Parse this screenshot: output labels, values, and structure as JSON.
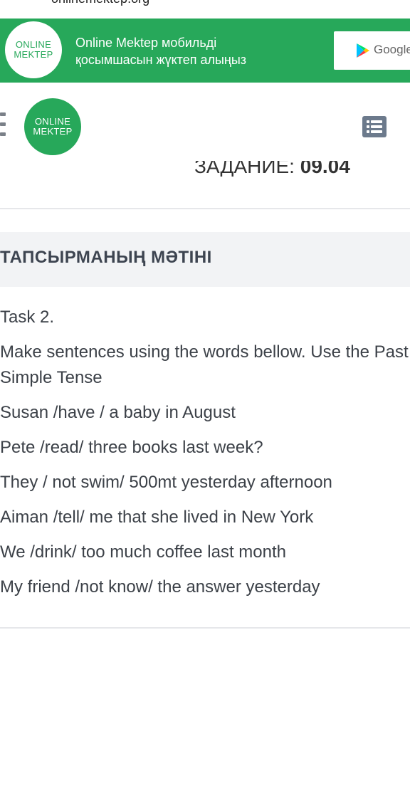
{
  "url_bar": {
    "url": "onlinemektep.org"
  },
  "banner": {
    "logo_line1": "ONLINE",
    "logo_line2": "MEKTEP",
    "promo_line1": "Online Mektep мобильді",
    "promo_line2": "қосымшасын жүктеп алыңыз",
    "store_label": "Google",
    "background": "#27a85a"
  },
  "header": {
    "logo_line1": "ONLINE",
    "logo_line2": "MEKTEP",
    "menu_icon": "hamburger-icon",
    "list_icon": "list-icon"
  },
  "deadline": {
    "prefix": "ЗАДАНИЕ: ",
    "value": "09.04"
  },
  "section": {
    "title": "ТАПСЫРМАНЫҢ МӘТІНІ"
  },
  "task": {
    "lines": [
      "Task 2.",
      "Make sentences using the words bellow. Use the Past Simple Tense",
      "Susan /have / a baby in August",
      "Pete /read/ three books last week?",
      "They / not swim/ 500mt yesterday afternoon",
      "Aiman /tell/ me that she lived in New York",
      "We /drink/ too much coffee last month",
      "My friend /not know/ the answer yesterday"
    ]
  }
}
